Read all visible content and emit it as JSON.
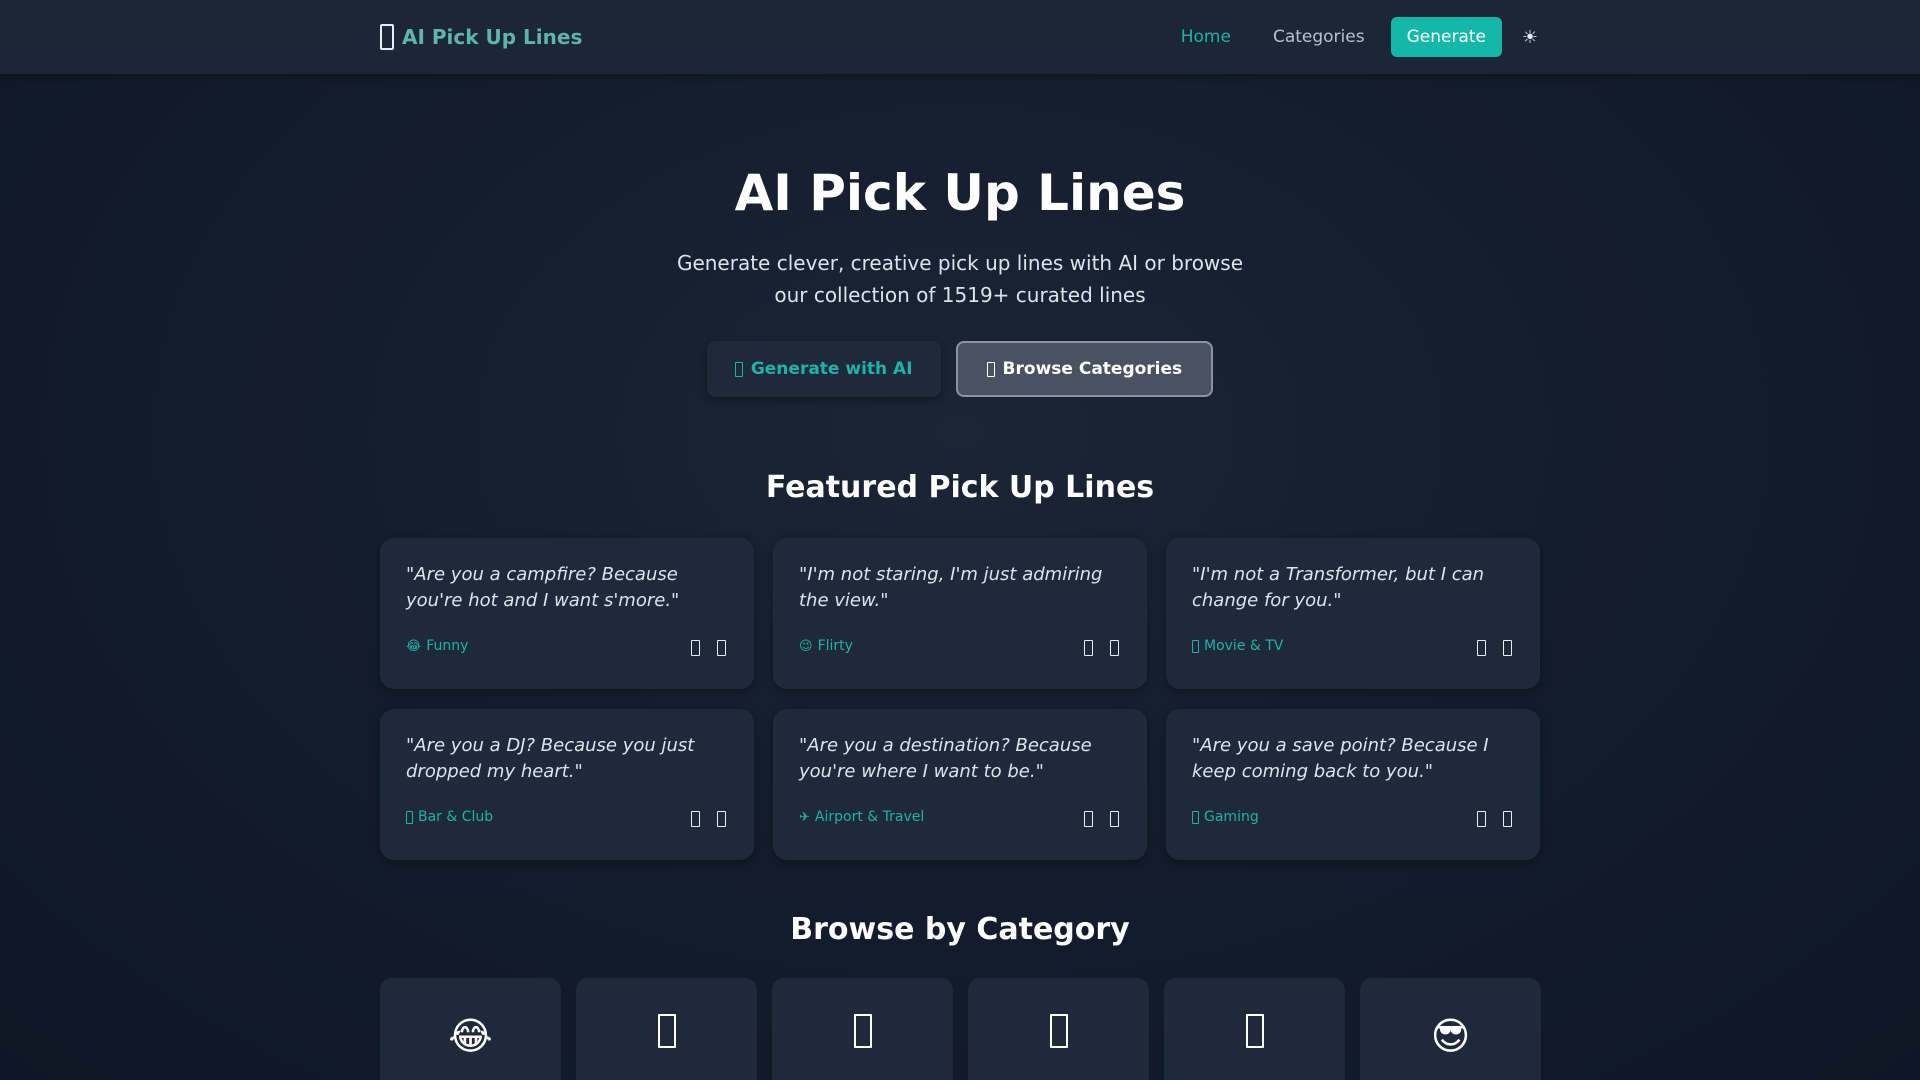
{
  "header": {
    "brand": "AI Pick Up Lines",
    "nav": {
      "home": "Home",
      "categories": "Categories",
      "generate": "Generate",
      "theme_toggle": "☀"
    }
  },
  "hero": {
    "title": "AI Pick Up Lines",
    "subtitle": "Generate clever, creative pick up lines with AI or browse our collection of 1519+ curated lines",
    "generate_button": "Generate with AI",
    "browse_button": "Browse Categories"
  },
  "featured": {
    "title": "Featured Pick Up Lines",
    "cards": [
      {
        "quote": "\"Are you a campfire? Because you're hot and I want s'more.\"",
        "category": "Funny",
        "category_icon": "😂"
      },
      {
        "quote": "\"I'm not staring, I'm just admiring the view.\"",
        "category": "Flirty",
        "category_icon": "😉"
      },
      {
        "quote": "\"I'm not a Transformer, but I can change for you.\"",
        "category": "Movie & TV",
        "category_icon": "movie-icon"
      },
      {
        "quote": "\"Are you a DJ? Because you just dropped my heart.\"",
        "category": "Bar & Club",
        "category_icon": "bar-icon"
      },
      {
        "quote": "\"Are you a destination? Because you're where I want to be.\"",
        "category": "Airport & Travel",
        "category_icon": "✈"
      },
      {
        "quote": "\"Are you a save point? Because I keep coming back to you.\"",
        "category": "Gaming",
        "category_icon": "gaming-icon"
      }
    ]
  },
  "browse": {
    "title": "Browse by Category",
    "tiles": [
      {
        "icon": "😂"
      },
      {
        "icon": "category-icon"
      },
      {
        "icon": "category-icon"
      },
      {
        "icon": "category-icon"
      },
      {
        "icon": "category-icon"
      },
      {
        "icon": "😎"
      }
    ]
  },
  "colors": {
    "accent": "#14b8a6",
    "background": "#0f172a",
    "card": "#1e293b"
  }
}
